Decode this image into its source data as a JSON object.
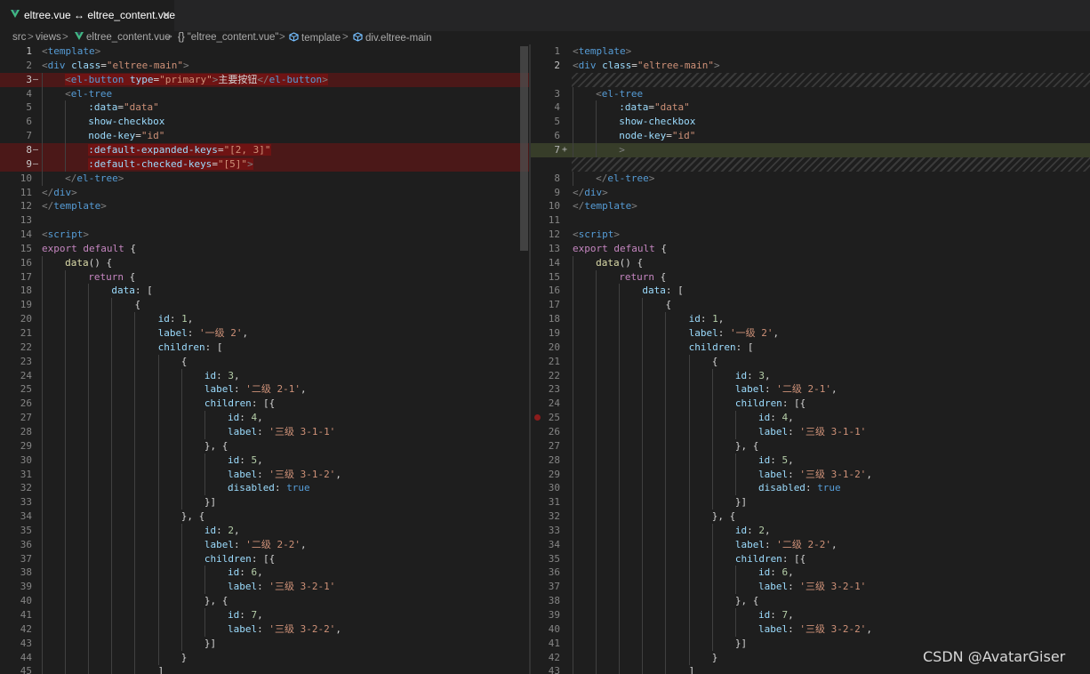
{
  "tab": {
    "title": "eltree.vue ↔ eltree_content.vue",
    "close": "✕",
    "icon": "vue-icon"
  },
  "breadcrumb": {
    "items": [
      {
        "label": "src",
        "icon": ""
      },
      {
        "label": "views",
        "icon": ""
      },
      {
        "label": "eltree_content.vue",
        "icon": "vue-icon"
      },
      {
        "label": "\"eltree_content.vue\"",
        "icon": "braces-icon"
      },
      {
        "label": "template",
        "icon": "cube-icon"
      },
      {
        "label": "div.eltree-main",
        "icon": "cube-icon"
      }
    ],
    "separator": ">"
  },
  "watermark": "CSDN @AvatarGiser",
  "colors": {
    "removed_line": "#4b1818",
    "removed_text": "#6f1313",
    "inserted_line": "#373d29",
    "background": "#1e1e1e"
  },
  "left": [
    {
      "n": "1",
      "cur": true,
      "t": [
        [
          "<",
          "br"
        ],
        [
          "template",
          "tag"
        ],
        [
          ">",
          "br"
        ]
      ]
    },
    {
      "n": "2",
      "t": [
        [
          "<",
          "br"
        ],
        [
          "div",
          "tag"
        ],
        [
          " "
        ],
        [
          "class",
          "attr"
        ],
        [
          "=",
          ""
        ],
        [
          "\"eltree-main\"",
          "str"
        ],
        [
          ">",
          "br"
        ]
      ]
    },
    {
      "n": "3",
      "m": "—",
      "k": "del",
      "d": 1,
      "t": [
        [
          "<",
          "br"
        ],
        [
          "el-button",
          "tag"
        ],
        [
          " "
        ],
        [
          "type",
          "attr"
        ],
        [
          "=",
          ""
        ],
        [
          "\"primary\"",
          "str"
        ],
        [
          ">",
          "br"
        ],
        [
          "主要按钮",
          "txt"
        ],
        [
          "</",
          "br"
        ],
        [
          "el-button",
          "tag"
        ],
        [
          ">",
          "br"
        ]
      ]
    },
    {
      "n": "4",
      "d": 1,
      "t": [
        [
          "<",
          "br"
        ],
        [
          "el-tree",
          "tag"
        ]
      ]
    },
    {
      "n": "5",
      "d": 2,
      "t": [
        [
          ":data",
          "attr"
        ],
        [
          "=",
          ""
        ],
        [
          "\"data\"",
          "str"
        ]
      ]
    },
    {
      "n": "6",
      "d": 2,
      "t": [
        [
          "show-checkbox",
          "attr"
        ]
      ]
    },
    {
      "n": "7",
      "d": 2,
      "t": [
        [
          "node-key",
          "attr"
        ],
        [
          "=",
          ""
        ],
        [
          "\"id\"",
          "str"
        ]
      ]
    },
    {
      "n": "8",
      "m": "—",
      "k": "del",
      "d": 2,
      "t": [
        [
          ":default-expanded-keys",
          "attr"
        ],
        [
          "=",
          ""
        ],
        [
          "\"[2, 3]\"",
          "str"
        ]
      ]
    },
    {
      "n": "9",
      "m": "—",
      "k": "del",
      "d": 2,
      "t": [
        [
          ":default-checked-keys",
          "attr"
        ],
        [
          "=",
          ""
        ],
        [
          "\"[5]\"",
          "str"
        ],
        [
          ">",
          "br"
        ]
      ]
    },
    {
      "n": "10",
      "d": 1,
      "t": [
        [
          "</",
          "br"
        ],
        [
          "el-tree",
          "tag"
        ],
        [
          ">",
          "br"
        ]
      ]
    },
    {
      "n": "11",
      "t": [
        [
          "</",
          "br"
        ],
        [
          "div",
          "tag"
        ],
        [
          ">",
          "br"
        ]
      ]
    },
    {
      "n": "12",
      "t": [
        [
          "</",
          "br"
        ],
        [
          "template",
          "tag"
        ],
        [
          ">",
          "br"
        ]
      ]
    },
    {
      "n": "13",
      "t": []
    },
    {
      "n": "14",
      "t": [
        [
          "<",
          "br"
        ],
        [
          "script",
          "tag"
        ],
        [
          ">",
          "br"
        ]
      ]
    },
    {
      "n": "15",
      "t": [
        [
          "export default",
          "kw"
        ],
        [
          " {",
          "pun"
        ]
      ]
    },
    {
      "n": "16",
      "d": 1,
      "t": [
        [
          "data",
          "fn"
        ],
        [
          "() {",
          "pun"
        ]
      ]
    },
    {
      "n": "17",
      "d": 2,
      "t": [
        [
          "return",
          "kw"
        ],
        [
          " {",
          "pun"
        ]
      ]
    },
    {
      "n": "18",
      "d": 3,
      "t": [
        [
          "data",
          "key"
        ],
        [
          ": [",
          "pun"
        ]
      ]
    },
    {
      "n": "19",
      "d": 4,
      "t": [
        [
          "{",
          "pun"
        ]
      ]
    },
    {
      "n": "20",
      "d": 5,
      "t": [
        [
          "id",
          "key"
        ],
        [
          ": ",
          "pun"
        ],
        [
          "1",
          "num"
        ],
        [
          ",",
          "pun"
        ]
      ]
    },
    {
      "n": "21",
      "d": 5,
      "t": [
        [
          "label",
          "key"
        ],
        [
          ": ",
          "pun"
        ],
        [
          "'一级 2'",
          "str"
        ],
        [
          ",",
          "pun"
        ]
      ]
    },
    {
      "n": "22",
      "d": 5,
      "t": [
        [
          "children",
          "key"
        ],
        [
          ": [",
          "pun"
        ]
      ]
    },
    {
      "n": "23",
      "d": 6,
      "t": [
        [
          "{",
          "pun"
        ]
      ]
    },
    {
      "n": "24",
      "d": 7,
      "t": [
        [
          "id",
          "key"
        ],
        [
          ": ",
          "pun"
        ],
        [
          "3",
          "num"
        ],
        [
          ",",
          "pun"
        ]
      ]
    },
    {
      "n": "25",
      "d": 7,
      "t": [
        [
          "label",
          "key"
        ],
        [
          ": ",
          "pun"
        ],
        [
          "'二级 2-1'",
          "str"
        ],
        [
          ",",
          "pun"
        ]
      ]
    },
    {
      "n": "26",
      "d": 7,
      "t": [
        [
          "children",
          "key"
        ],
        [
          ": [{",
          "pun"
        ]
      ]
    },
    {
      "n": "27",
      "d": 8,
      "t": [
        [
          "id",
          "key"
        ],
        [
          ": ",
          "pun"
        ],
        [
          "4",
          "num"
        ],
        [
          ",",
          "pun"
        ]
      ]
    },
    {
      "n": "28",
      "d": 8,
      "t": [
        [
          "label",
          "key"
        ],
        [
          ": ",
          "pun"
        ],
        [
          "'三级 3-1-1'",
          "str"
        ]
      ]
    },
    {
      "n": "29",
      "d": 7,
      "t": [
        [
          "}, {",
          "pun"
        ]
      ]
    },
    {
      "n": "30",
      "d": 8,
      "t": [
        [
          "id",
          "key"
        ],
        [
          ": ",
          "pun"
        ],
        [
          "5",
          "num"
        ],
        [
          ",",
          "pun"
        ]
      ]
    },
    {
      "n": "31",
      "d": 8,
      "t": [
        [
          "label",
          "key"
        ],
        [
          ": ",
          "pun"
        ],
        [
          "'三级 3-1-2'",
          "str"
        ],
        [
          ",",
          "pun"
        ]
      ]
    },
    {
      "n": "32",
      "d": 8,
      "t": [
        [
          "disabled",
          "key"
        ],
        [
          ": ",
          "pun"
        ],
        [
          "true",
          "bool"
        ]
      ]
    },
    {
      "n": "33",
      "d": 7,
      "t": [
        [
          "}]",
          "pun"
        ]
      ]
    },
    {
      "n": "34",
      "d": 6,
      "t": [
        [
          "}, {",
          "pun"
        ]
      ]
    },
    {
      "n": "35",
      "d": 7,
      "t": [
        [
          "id",
          "key"
        ],
        [
          ": ",
          "pun"
        ],
        [
          "2",
          "num"
        ],
        [
          ",",
          "pun"
        ]
      ]
    },
    {
      "n": "36",
      "d": 7,
      "t": [
        [
          "label",
          "key"
        ],
        [
          ": ",
          "pun"
        ],
        [
          "'二级 2-2'",
          "str"
        ],
        [
          ",",
          "pun"
        ]
      ]
    },
    {
      "n": "37",
      "d": 7,
      "t": [
        [
          "children",
          "key"
        ],
        [
          ": [{",
          "pun"
        ]
      ]
    },
    {
      "n": "38",
      "d": 8,
      "t": [
        [
          "id",
          "key"
        ],
        [
          ": ",
          "pun"
        ],
        [
          "6",
          "num"
        ],
        [
          ",",
          "pun"
        ]
      ]
    },
    {
      "n": "39",
      "d": 8,
      "t": [
        [
          "label",
          "key"
        ],
        [
          ": ",
          "pun"
        ],
        [
          "'三级 3-2-1'",
          "str"
        ]
      ]
    },
    {
      "n": "40",
      "d": 7,
      "t": [
        [
          "}, {",
          "pun"
        ]
      ]
    },
    {
      "n": "41",
      "d": 8,
      "t": [
        [
          "id",
          "key"
        ],
        [
          ": ",
          "pun"
        ],
        [
          "7",
          "num"
        ],
        [
          ",",
          "pun"
        ]
      ]
    },
    {
      "n": "42",
      "d": 8,
      "t": [
        [
          "label",
          "key"
        ],
        [
          ": ",
          "pun"
        ],
        [
          "'三级 3-2-2'",
          "str"
        ],
        [
          ",",
          "pun"
        ]
      ]
    },
    {
      "n": "43",
      "d": 7,
      "t": [
        [
          "}]",
          "pun"
        ]
      ]
    },
    {
      "n": "44",
      "d": 6,
      "t": [
        [
          "}",
          "pun"
        ]
      ]
    },
    {
      "n": "45",
      "d": 5,
      "t": [
        [
          "]",
          "pun"
        ]
      ]
    }
  ],
  "right": [
    {
      "n": "1",
      "t": [
        [
          "<",
          "br"
        ],
        [
          "template",
          "tag"
        ],
        [
          ">",
          "br"
        ]
      ]
    },
    {
      "n": "2",
      "cur": true,
      "t": [
        [
          "<",
          "br"
        ],
        [
          "div",
          "tag"
        ],
        [
          " "
        ],
        [
          "class",
          "attr"
        ],
        [
          "=",
          ""
        ],
        [
          "\"eltree-main\"",
          "str"
        ],
        [
          ">",
          "br"
        ]
      ]
    },
    {
      "n": "",
      "k": "filler",
      "t": []
    },
    {
      "n": "3",
      "d": 1,
      "t": [
        [
          "<",
          "br"
        ],
        [
          "el-tree",
          "tag"
        ]
      ]
    },
    {
      "n": "4",
      "d": 2,
      "t": [
        [
          ":data",
          "attr"
        ],
        [
          "=",
          ""
        ],
        [
          "\"data\"",
          "str"
        ]
      ]
    },
    {
      "n": "5",
      "d": 2,
      "t": [
        [
          "show-checkbox",
          "attr"
        ]
      ]
    },
    {
      "n": "6",
      "d": 2,
      "t": [
        [
          "node-key",
          "attr"
        ],
        [
          "=",
          ""
        ],
        [
          "\"id\"",
          "str"
        ]
      ]
    },
    {
      "n": "7",
      "m": "+",
      "k": "ins",
      "d": 2,
      "t": [
        [
          ">",
          "br"
        ]
      ]
    },
    {
      "n": "",
      "k": "filler",
      "t": []
    },
    {
      "n": "8",
      "d": 1,
      "t": [
        [
          "</",
          "br"
        ],
        [
          "el-tree",
          "tag"
        ],
        [
          ">",
          "br"
        ]
      ]
    },
    {
      "n": "9",
      "t": [
        [
          "</",
          "br"
        ],
        [
          "div",
          "tag"
        ],
        [
          ">",
          "br"
        ]
      ]
    },
    {
      "n": "10",
      "t": [
        [
          "</",
          "br"
        ],
        [
          "template",
          "tag"
        ],
        [
          ">",
          "br"
        ]
      ]
    },
    {
      "n": "11",
      "t": []
    },
    {
      "n": "12",
      "t": [
        [
          "<",
          "br"
        ],
        [
          "script",
          "tag"
        ],
        [
          ">",
          "br"
        ]
      ]
    },
    {
      "n": "13",
      "t": [
        [
          "export default",
          "kw"
        ],
        [
          " {",
          "pun"
        ]
      ]
    },
    {
      "n": "14",
      "d": 1,
      "t": [
        [
          "data",
          "fn"
        ],
        [
          "() {",
          "pun"
        ]
      ]
    },
    {
      "n": "15",
      "d": 2,
      "t": [
        [
          "return",
          "kw"
        ],
        [
          " {",
          "pun"
        ]
      ]
    },
    {
      "n": "16",
      "d": 3,
      "t": [
        [
          "data",
          "key"
        ],
        [
          ": [",
          "pun"
        ]
      ]
    },
    {
      "n": "17",
      "d": 4,
      "t": [
        [
          "{",
          "pun"
        ]
      ]
    },
    {
      "n": "18",
      "d": 5,
      "t": [
        [
          "id",
          "key"
        ],
        [
          ": ",
          "pun"
        ],
        [
          "1",
          "num"
        ],
        [
          ",",
          "pun"
        ]
      ]
    },
    {
      "n": "19",
      "d": 5,
      "t": [
        [
          "label",
          "key"
        ],
        [
          ": ",
          "pun"
        ],
        [
          "'一级 2'",
          "str"
        ],
        [
          ",",
          "pun"
        ]
      ]
    },
    {
      "n": "20",
      "d": 5,
      "t": [
        [
          "children",
          "key"
        ],
        [
          ": [",
          "pun"
        ]
      ]
    },
    {
      "n": "21",
      "d": 6,
      "t": [
        [
          "{",
          "pun"
        ]
      ]
    },
    {
      "n": "22",
      "d": 7,
      "t": [
        [
          "id",
          "key"
        ],
        [
          ": ",
          "pun"
        ],
        [
          "3",
          "num"
        ],
        [
          ",",
          "pun"
        ]
      ]
    },
    {
      "n": "23",
      "d": 7,
      "t": [
        [
          "label",
          "key"
        ],
        [
          ": ",
          "pun"
        ],
        [
          "'二级 2-1'",
          "str"
        ],
        [
          ",",
          "pun"
        ]
      ]
    },
    {
      "n": "24",
      "d": 7,
      "t": [
        [
          "children",
          "key"
        ],
        [
          ": [{",
          "pun"
        ]
      ]
    },
    {
      "n": "25",
      "d": 8,
      "t": [
        [
          "id",
          "key"
        ],
        [
          ": ",
          "pun"
        ],
        [
          "4",
          "num"
        ],
        [
          ",",
          "pun"
        ]
      ]
    },
    {
      "n": "26",
      "d": 8,
      "t": [
        [
          "label",
          "key"
        ],
        [
          ": ",
          "pun"
        ],
        [
          "'三级 3-1-1'",
          "str"
        ]
      ]
    },
    {
      "n": "27",
      "d": 7,
      "t": [
        [
          "}, {",
          "pun"
        ]
      ]
    },
    {
      "n": "28",
      "d": 8,
      "t": [
        [
          "id",
          "key"
        ],
        [
          ": ",
          "pun"
        ],
        [
          "5",
          "num"
        ],
        [
          ",",
          "pun"
        ]
      ]
    },
    {
      "n": "29",
      "d": 8,
      "t": [
        [
          "label",
          "key"
        ],
        [
          ": ",
          "pun"
        ],
        [
          "'三级 3-1-2'",
          "str"
        ],
        [
          ",",
          "pun"
        ]
      ]
    },
    {
      "n": "30",
      "d": 8,
      "t": [
        [
          "disabled",
          "key"
        ],
        [
          ": ",
          "pun"
        ],
        [
          "true",
          "bool"
        ]
      ]
    },
    {
      "n": "31",
      "d": 7,
      "t": [
        [
          "}]",
          "pun"
        ]
      ]
    },
    {
      "n": "32",
      "d": 6,
      "t": [
        [
          "}, {",
          "pun"
        ]
      ]
    },
    {
      "n": "33",
      "d": 7,
      "t": [
        [
          "id",
          "key"
        ],
        [
          ": ",
          "pun"
        ],
        [
          "2",
          "num"
        ],
        [
          ",",
          "pun"
        ]
      ]
    },
    {
      "n": "34",
      "d": 7,
      "t": [
        [
          "label",
          "key"
        ],
        [
          ": ",
          "pun"
        ],
        [
          "'二级 2-2'",
          "str"
        ],
        [
          ",",
          "pun"
        ]
      ]
    },
    {
      "n": "35",
      "d": 7,
      "t": [
        [
          "children",
          "key"
        ],
        [
          ": [{",
          "pun"
        ]
      ]
    },
    {
      "n": "36",
      "d": 8,
      "t": [
        [
          "id",
          "key"
        ],
        [
          ": ",
          "pun"
        ],
        [
          "6",
          "num"
        ],
        [
          ",",
          "pun"
        ]
      ]
    },
    {
      "n": "37",
      "d": 8,
      "t": [
        [
          "label",
          "key"
        ],
        [
          ": ",
          "pun"
        ],
        [
          "'三级 3-2-1'",
          "str"
        ]
      ]
    },
    {
      "n": "38",
      "d": 7,
      "t": [
        [
          "}, {",
          "pun"
        ]
      ]
    },
    {
      "n": "39",
      "d": 8,
      "t": [
        [
          "id",
          "key"
        ],
        [
          ": ",
          "pun"
        ],
        [
          "7",
          "num"
        ],
        [
          ",",
          "pun"
        ]
      ]
    },
    {
      "n": "40",
      "d": 8,
      "t": [
        [
          "label",
          "key"
        ],
        [
          ": ",
          "pun"
        ],
        [
          "'三级 3-2-2'",
          "str"
        ],
        [
          ",",
          "pun"
        ]
      ]
    },
    {
      "n": "41",
      "d": 7,
      "t": [
        [
          "}]",
          "pun"
        ]
      ]
    },
    {
      "n": "42",
      "d": 6,
      "t": [
        [
          "}",
          "pun"
        ]
      ]
    },
    {
      "n": "43",
      "d": 5,
      "t": [
        [
          "]",
          "pun"
        ]
      ]
    }
  ]
}
